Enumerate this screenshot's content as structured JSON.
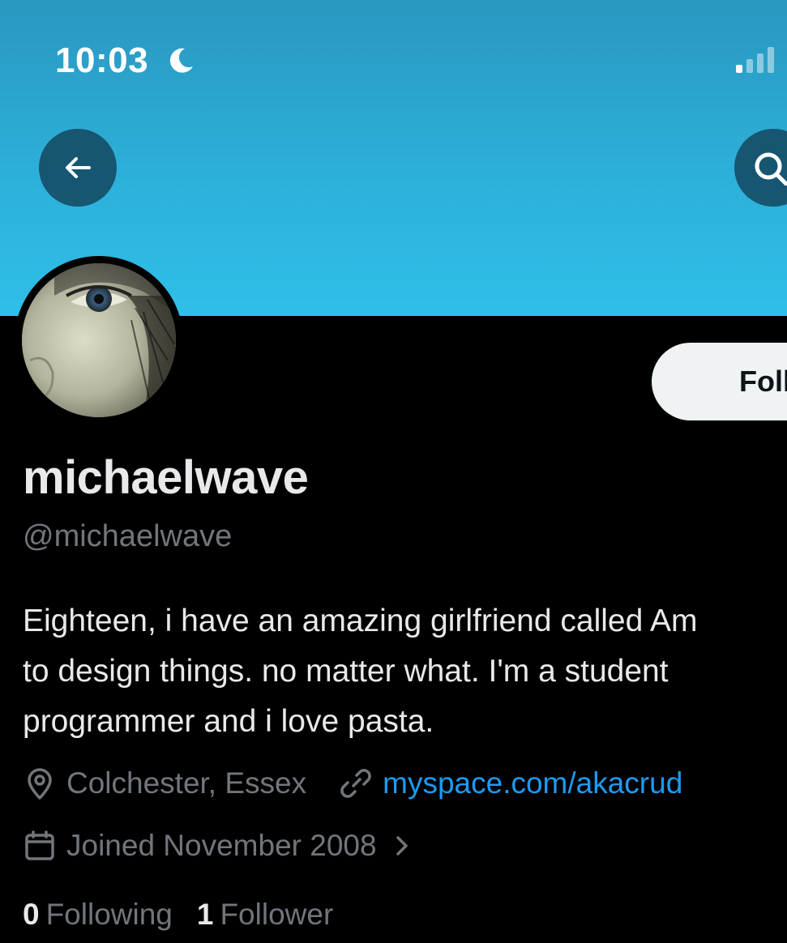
{
  "status_bar": {
    "time": "10:03",
    "focus_icon": "moon-icon",
    "signal_icon": "cellular-signal-icon"
  },
  "header": {
    "back_icon": "arrow-left-icon",
    "search_icon": "search-icon",
    "banner_color": "#2cb0d9"
  },
  "profile": {
    "display_name": "michaelwave",
    "handle": "@michaelwave",
    "follow_label": "Foll",
    "bio_lines": [
      "Eighteen, i have an amazing girlfriend called Am",
      "to design things. no matter what. I'm a student",
      "programmer and i love pasta."
    ],
    "location": "Colchester, Essex",
    "website": "myspace.com/akacrud",
    "joined": "Joined November 2008",
    "following_count": "0",
    "following_label": "Following",
    "followers_count": "1",
    "followers_label": "Follower"
  },
  "colors": {
    "link": "#1d9bf0",
    "muted_text": "#71767b",
    "primary_text": "#e7e9ea",
    "background": "#000000"
  }
}
